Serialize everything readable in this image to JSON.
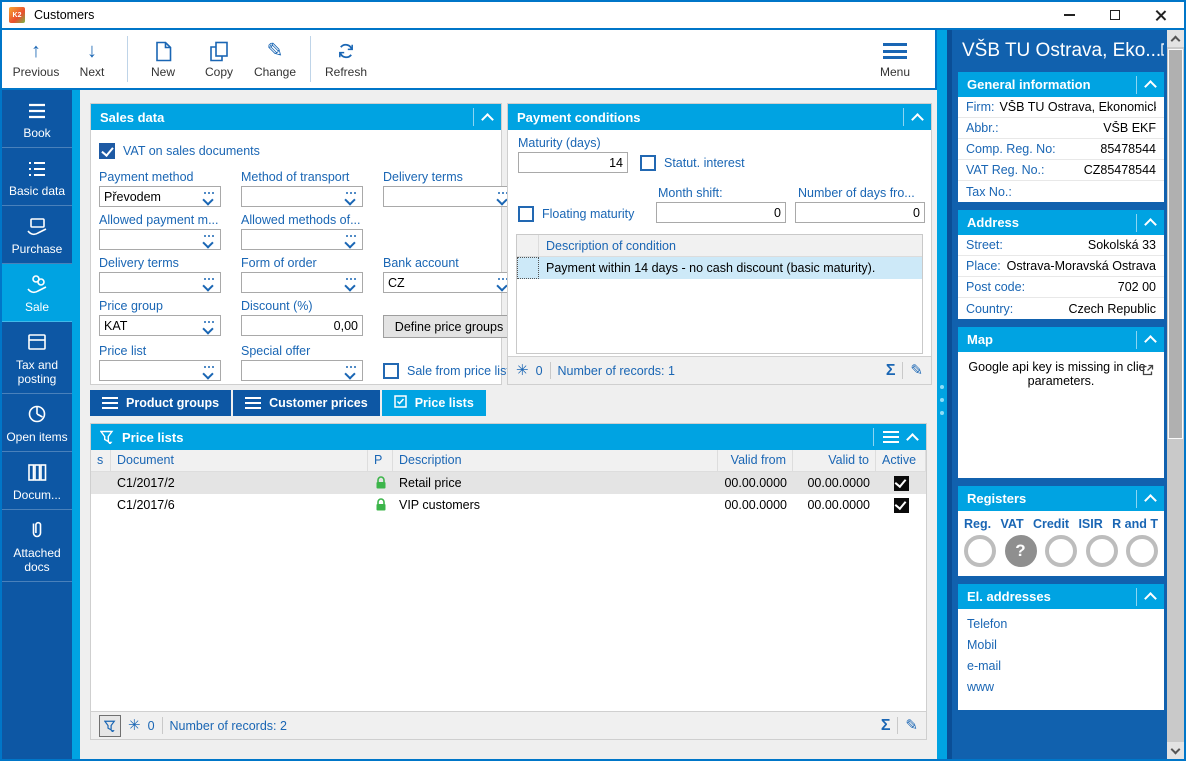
{
  "window": {
    "title": "Customers",
    "logo_text": "K2"
  },
  "toolbar": {
    "previous": "Previous",
    "next": "Next",
    "new": "New",
    "copy": "Copy",
    "change": "Change",
    "refresh": "Refresh",
    "menu": "Menu"
  },
  "glyphs": {
    "arrow_up": "↑",
    "arrow_down": "↓",
    "pencil": "✎",
    "snowflake": "✳",
    "sigma": "Σ"
  },
  "nav": {
    "items": [
      {
        "label": "Book"
      },
      {
        "label": "Basic data"
      },
      {
        "label": "Purchase"
      },
      {
        "label": "Sale"
      },
      {
        "label": "Tax and posting"
      },
      {
        "label": "Open items"
      },
      {
        "label": "Docum..."
      },
      {
        "label": "Attached docs"
      }
    ]
  },
  "sales": {
    "title": "Sales data",
    "vat_label": "VAT on sales documents",
    "payment_method": {
      "label": "Payment method",
      "value": "Převodem"
    },
    "method_of_transport": {
      "label": "Method of transport",
      "value": ""
    },
    "delivery_terms_top": {
      "label": "Delivery terms",
      "value": ""
    },
    "allowed_payment_methods": {
      "label": "Allowed payment m...",
      "value": ""
    },
    "allowed_methods_of": {
      "label": "Allowed methods of...",
      "value": ""
    },
    "delivery_terms": {
      "label": "Delivery terms",
      "value": ""
    },
    "form_of_order": {
      "label": "Form of order",
      "value": ""
    },
    "bank_account": {
      "label": "Bank account",
      "value": "CZ"
    },
    "price_group": {
      "label": "Price group",
      "value": "KAT"
    },
    "discount": {
      "label": "Discount (%)",
      "value": "0,00"
    },
    "define_price_groups_button": "Define price groups",
    "price_list": {
      "label": "Price list",
      "value": ""
    },
    "special_offer": {
      "label": "Special offer",
      "value": ""
    },
    "sale_from_price_list_label": "Sale from price list..."
  },
  "payment": {
    "title": "Payment conditions",
    "maturity": {
      "label": "Maturity (days)",
      "value": "14"
    },
    "statut_interest_label": "Statut. interest",
    "floating_maturity_label": "Floating maturity",
    "month_shift": {
      "label": "Month shift:",
      "value": "0"
    },
    "number_of_days": {
      "label": "Number of days fro...",
      "value": "0"
    },
    "table": {
      "description_header": "Description of condition",
      "rows": [
        "Payment within 14 days - no cash discount (basic maturity)."
      ]
    },
    "status": {
      "flake_count": "0",
      "records_text": "Number of records: 1"
    }
  },
  "tabs": {
    "items": [
      {
        "label": "Product groups"
      },
      {
        "label": "Customer prices"
      },
      {
        "label": "Price lists"
      }
    ]
  },
  "price_lists": {
    "title": "Price lists",
    "columns": {
      "s": "s",
      "document": "Document",
      "p": "P",
      "description": "Description",
      "valid_from": "Valid from",
      "valid_to": "Valid to",
      "active": "Active"
    },
    "rows": [
      {
        "document": "C1/2017/2",
        "description": "Retail price",
        "valid_from": "00.00.0000",
        "valid_to": "00.00.0000",
        "active": true
      },
      {
        "document": "C1/2017/6",
        "description": "VIP customers",
        "valid_from": "00.00.0000",
        "valid_to": "00.00.0000",
        "active": true
      }
    ],
    "status": {
      "flake_count": "0",
      "records_text": "Number of records: 2"
    }
  },
  "right_panel": {
    "title": "VŠB TU Ostrava, Eko...",
    "general_information": {
      "title": "General information",
      "firm": {
        "label": "Firm:",
        "value": "VŠB TU Ostrava, Ekonomická ..."
      },
      "abbr": {
        "label": "Abbr.:",
        "value": "VŠB EKF"
      },
      "reg_no": {
        "label": "Comp. Reg. No:",
        "value": "85478544"
      },
      "vat_no": {
        "label": "VAT Reg. No.:",
        "value": "CZ85478544"
      },
      "tax_no": {
        "label": "Tax No.:",
        "value": ""
      }
    },
    "address": {
      "title": "Address",
      "street": {
        "label": "Street:",
        "value": "Sokolská 33"
      },
      "place": {
        "label": "Place:",
        "value": "Ostrava-Moravská Ostrava"
      },
      "postcode": {
        "label": "Post code:",
        "value": "702 00"
      },
      "country": {
        "label": "Country:",
        "value": "Czech Republic"
      }
    },
    "map": {
      "title": "Map",
      "line1": "Google api key is missing in clie",
      "line2": "parameters."
    },
    "registers": {
      "title": "Registers",
      "labels": [
        "Reg.",
        "VAT",
        "Credit",
        "ISIR",
        "R and T"
      ],
      "unknown_mark": "?"
    },
    "el_addresses": {
      "title": "El. addresses",
      "items": [
        "Telefon",
        "Mobil",
        "e-mail",
        "www"
      ]
    }
  },
  "colors": {
    "accent_cyan": "#00A3E2",
    "dark_blue": "#0D57A4",
    "right_panel_blue": "#1161AE",
    "label_blue": "#1A66B4",
    "lock_green": "#3CB54A",
    "selected_row_blue": "#CDE9F8",
    "window_border_blue": "#0076C8"
  }
}
